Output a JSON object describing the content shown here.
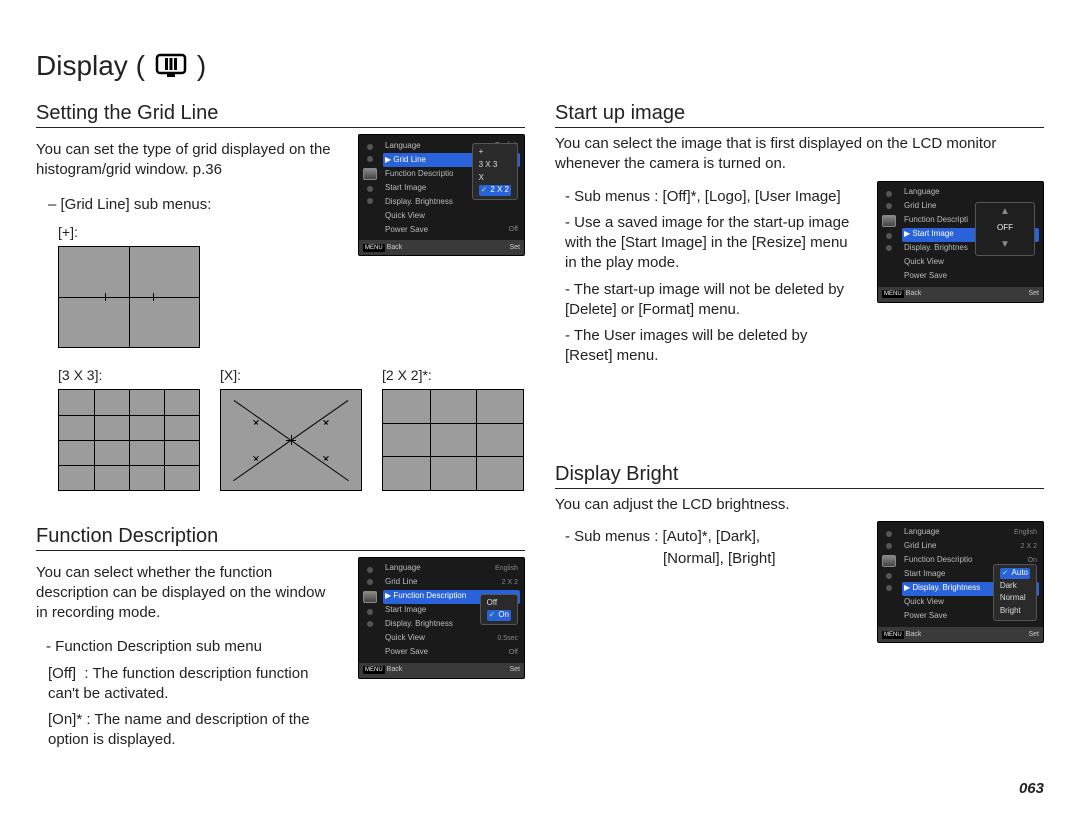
{
  "page_title": "Display (",
  "page_title_suffix": ")",
  "page_number": "063",
  "sections": {
    "grid": {
      "heading": "Setting the Grid Line",
      "intro": "You can set the type of grid displayed on the histogram/grid window. p.36",
      "submenu_label": "– [Grid Line] sub menus:",
      "items": {
        "plus": "[+]:",
        "3x3": "[3 X 3]:",
        "x": "[X]:",
        "2x2": "[2 X 2]*:"
      },
      "camera": {
        "rows": [
          {
            "l": "Language",
            "r": "English"
          },
          {
            "l": "Grid Line",
            "r": ""
          },
          {
            "l": "Function Descriptio",
            "r": ""
          },
          {
            "l": "Start Image",
            "r": ""
          },
          {
            "l": "Display. Brightness",
            "r": ""
          },
          {
            "l": "Quick View",
            "r": ""
          },
          {
            "l": "Power Save",
            "r": "Off"
          }
        ],
        "selected_index": 1,
        "submenu": [
          "+",
          "3 X 3",
          "X",
          "2 X 2"
        ],
        "submenu_sel": 3,
        "back": "Back",
        "set": "Set"
      }
    },
    "func": {
      "heading": "Function Description",
      "intro": "You can select whether the function description can be displayed on the window in recording mode.",
      "sub_label": "- Function Description sub menu",
      "off_line": "[Off]  : The function description function can't be activated.",
      "on_line": "[On]* : The name and description of the option is displayed.",
      "camera": {
        "rows": [
          {
            "l": "Language",
            "r": "English"
          },
          {
            "l": "Grid Line",
            "r": "2 X 2"
          },
          {
            "l": "Function Description",
            "r": ""
          },
          {
            "l": "Start Image",
            "r": ""
          },
          {
            "l": "Display. Brightness",
            "r": ""
          },
          {
            "l": "Quick View",
            "r": "0.5sec"
          },
          {
            "l": "Power Save",
            "r": "Off"
          }
        ],
        "selected_index": 2,
        "submenu": [
          "Off",
          "On"
        ],
        "submenu_sel": 1,
        "back": "Back",
        "set": "Set"
      }
    },
    "startup": {
      "heading": "Start up image",
      "intro": "You can select the image that is first displayed on the LCD monitor whenever the camera is turned on.",
      "bullets": [
        "- Sub menus : [Off]*, [Logo], [User Image]",
        "- Use a saved image for the start-up image with the [Start Image] in the [Resize] menu in the play mode.",
        "- The start-up image will not be deleted by [Delete] or [Format] menu.",
        "- The User images will be deleted by [Reset] menu."
      ],
      "camera": {
        "rows": [
          {
            "l": "Language",
            "r": ""
          },
          {
            "l": "Grid Line",
            "r": ""
          },
          {
            "l": "Function Descripti",
            "r": ""
          },
          {
            "l": "Start Image",
            "r": ""
          },
          {
            "l": "Display. Brightnes",
            "r": ""
          },
          {
            "l": "Quick View",
            "r": ""
          },
          {
            "l": "Power Save",
            "r": ""
          }
        ],
        "selected_index": 3,
        "big_sub": "OFF",
        "back": "Back",
        "set": "Set"
      }
    },
    "bright": {
      "heading": "Display Bright",
      "intro": "You can adjust the LCD brightness.",
      "sub_line1": "- Sub menus : [Auto]*, [Dark],",
      "sub_line2": "[Normal], [Bright]",
      "camera": {
        "rows": [
          {
            "l": "Language",
            "r": "English"
          },
          {
            "l": "Grid Line",
            "r": "2 X 2"
          },
          {
            "l": "Function Descriptio",
            "r": "On"
          },
          {
            "l": "Start Image",
            "r": ""
          },
          {
            "l": "Display. Brightness",
            "r": ""
          },
          {
            "l": "Quick View",
            "r": ""
          },
          {
            "l": "Power Save",
            "r": ""
          }
        ],
        "selected_index": 4,
        "submenu": [
          "Auto",
          "Dark",
          "Normal",
          "Bright"
        ],
        "submenu_sel": 0,
        "back": "Back",
        "set": "Set"
      }
    }
  }
}
